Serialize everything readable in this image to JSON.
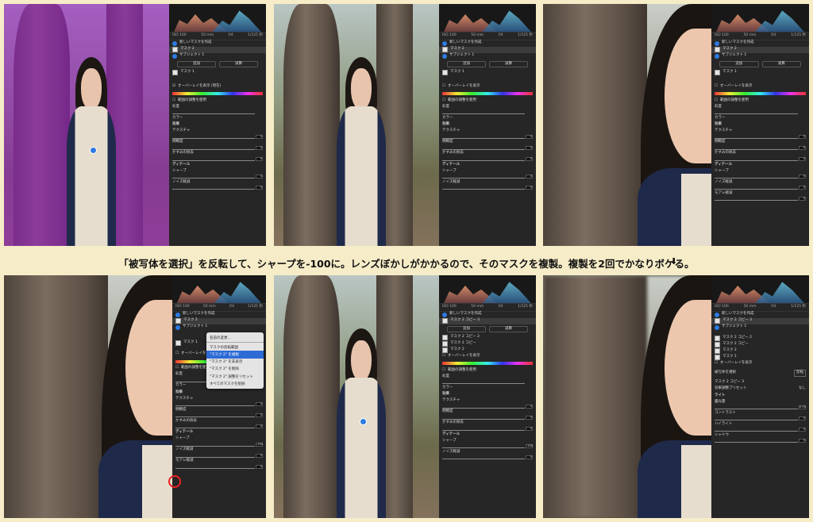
{
  "caption": "「被写体を選択」を反転して、シャープを-100に。レンズぼかしがかかるので、そのマスクを複製。複製を2回でかなりボケる。",
  "arrow": "⬇",
  "panel": {
    "exif": [
      "ISO 100",
      "50 mm",
      "f/4",
      "1/125 秒"
    ],
    "create_mask": "新しいマスクを作成",
    "mask2": "マスク 2",
    "subject1": "サブジェクト 1",
    "add": "追加",
    "subtract": "減算",
    "mask1": "マスク 1",
    "overlay_on": "オーバーレイを表示 (現在)",
    "overlay": "オーバーレイを表示",
    "range_adjust": "範囲の調整を使用",
    "saturation": "彩度",
    "color": "カラー",
    "effects": "効果",
    "texture": "テクスチャ",
    "clarity": "明瞭度",
    "dehaze": "かすみの除去",
    "detail": "ディテール",
    "sharpness": "シャープ",
    "noise": "ノイズ軽減",
    "moire": "モアレ軽減",
    "fringe": "フリンジ軽減",
    "zero": "0",
    "minus100": "-100",
    "mask2copy3": "マスク 2 コピー 3",
    "mask2copy2": "マスク 2 コピー 2",
    "mask2copy": "マスク 2 コピー",
    "select_subject": "被写体を選択",
    "invert": "反転",
    "preset": "効果調整プリセット",
    "none": "なし",
    "light": "ライト",
    "exposure": "露光量",
    "contrast": "コントラスト",
    "highlights": "ハイライト",
    "shadows": "シャドウ",
    "whites": "白レベル",
    "blacks": "黒レベル",
    "exp_val": "0.00"
  },
  "context_menu": {
    "items": [
      "名前の変更...",
      "マスクの反転範囲",
      "\"マスク 2\" を複製",
      "\"マスク 2\" を非表示",
      "\"マスク 2\" を削除",
      "\"マスク 2\" 調整をリセット",
      "すべてのマスクを削除"
    ],
    "highlighted": "\"マスク 2\" を複製",
    "separator_after": 1
  }
}
